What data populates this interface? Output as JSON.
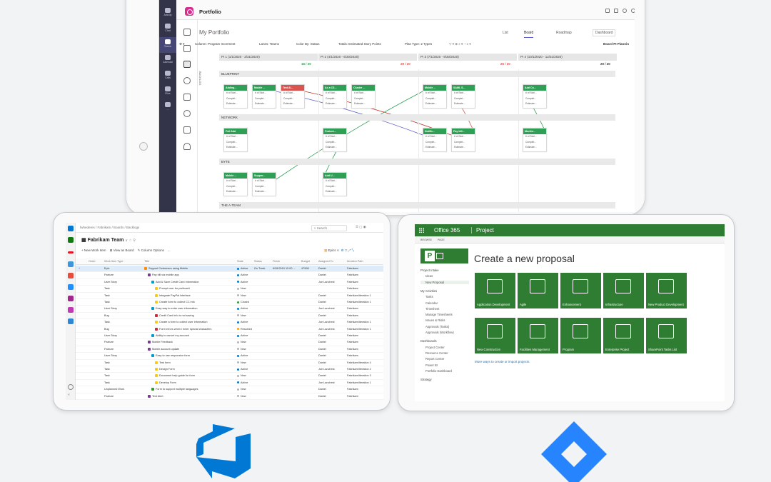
{
  "teams": {
    "rail": [
      {
        "label": "Activity"
      },
      {
        "label": "Chat"
      },
      {
        "label": "Teams",
        "active": true
      },
      {
        "label": "Calendar"
      },
      {
        "label": "Calls"
      },
      {
        "label": "Files"
      },
      {
        "label": "..."
      }
    ],
    "app_title": "Portfolio",
    "page_title": "My Portfolio",
    "views": [
      "List",
      "Board",
      "Roadmap",
      "Dashboard"
    ],
    "active_view": "Board",
    "filters": {
      "column": "Column: Program Increment",
      "lanes": "Lanes: Teams",
      "color": "Color By: Status",
      "totals": "Totals: Estimated Story Points",
      "plan": "Plan Type: 2 Types",
      "board": "Board PI Plannin"
    },
    "side_tab": "BACKLOG",
    "pis": [
      {
        "label": "PI 1 (1/1/2020 - 3/31/2020)",
        "count": "16 / 20",
        "color": "#2e9f55"
      },
      {
        "label": "PI 2 (4/1/2020 - 6/30/2020)",
        "count": "29 / 20",
        "color": "#d9534f"
      },
      {
        "label": "PI 3 (7/1/2020 - 9/30/2020)",
        "count": "25 / 20",
        "color": "#d9534f"
      },
      {
        "label": "PI 4 (10/1/2020 - 12/31/2020)",
        "count": "20 / 20",
        "color": "#333333"
      }
    ],
    "lanes": [
      "BLUEPRINT",
      "NETWORK",
      "BYTE",
      "THE A-TEAM"
    ],
    "card_lines": [
      "# of Stori...",
      "Complet...",
      "Estimate..."
    ],
    "cards": [
      {
        "title": "Adding...",
        "lane": 0,
        "col": 0,
        "slot": 0,
        "red": false
      },
      {
        "title": "Mobile ...",
        "lane": 0,
        "col": 0,
        "slot": 1,
        "red": false
      },
      {
        "title": "Test Al...",
        "lane": 0,
        "col": 0,
        "slot": 2,
        "red": true
      },
      {
        "title": "As a CS...",
        "lane": 0,
        "col": 1,
        "slot": 0,
        "red": false
      },
      {
        "title": "Cluster ...",
        "lane": 0,
        "col": 1,
        "slot": 1,
        "red": false
      },
      {
        "title": "Mobile ...",
        "lane": 0,
        "col": 2,
        "slot": 0,
        "red": false
      },
      {
        "title": "SAML S...",
        "lane": 0,
        "col": 2,
        "slot": 1,
        "red": false
      },
      {
        "title": "Add Co...",
        "lane": 0,
        "col": 3,
        "slot": 0,
        "red": false
      },
      {
        "title": "Full Add",
        "lane": 1,
        "col": 0,
        "slot": 0,
        "red": false
      },
      {
        "title": "Feature...",
        "lane": 1,
        "col": 1,
        "slot": 0,
        "red": false
      },
      {
        "title": "Notific...",
        "lane": 1,
        "col": 2,
        "slot": 0,
        "red": false
      },
      {
        "title": "Pay bill...",
        "lane": 1,
        "col": 2,
        "slot": 1,
        "red": false
      },
      {
        "title": "Monito...",
        "lane": 1,
        "col": 3,
        "slot": 0,
        "red": false
      },
      {
        "title": "Mobile ...",
        "lane": 2,
        "col": 0,
        "slot": 0,
        "red": false
      },
      {
        "title": "Suppor...",
        "lane": 2,
        "col": 0,
        "slot": 1,
        "red": false
      },
      {
        "title": "Add U...",
        "lane": 2,
        "col": 1,
        "slot": 0,
        "red": false
      }
    ]
  },
  "ado": {
    "breadcrumb": "fwhederes  /  Fabrikam  /  Boards  /  Backlogs",
    "search": "Search",
    "team": "Fabrikam Team",
    "toolbar": [
      "+ New Work Item",
      "View as Board",
      "Column Options",
      "..."
    ],
    "epics": "Epics",
    "columns": [
      "Order",
      "Work Item Type",
      "Title",
      "State",
      "Status",
      "Finish",
      "Budget",
      "Assigned To",
      "Iteration Path"
    ],
    "rows": [
      {
        "type": "Epic",
        "title": "Support Customers using Mobile",
        "state": "Active",
        "status": "On Track",
        "finish": "6/28/2019 12:00 ...",
        "budget": "47598",
        "assigned": "Daniel",
        "iter": "Fabrikam",
        "sel": true,
        "ind": 0,
        "tc": "#ff8c00"
      },
      {
        "type": "Feature",
        "title": "Pay bill via mobile app",
        "state": "Active",
        "status": "",
        "finish": "",
        "budget": "",
        "assigned": "Daniel",
        "iter": "Fabrikam",
        "ind": 1,
        "tc": "#773b93"
      },
      {
        "type": "User Story",
        "title": "Add & Save Credit Card Information",
        "state": "Active",
        "status": "",
        "finish": "",
        "budget": "",
        "assigned": "Joe Lanchest",
        "iter": "Fabrikam",
        "ind": 2,
        "tc": "#009ccc"
      },
      {
        "type": "Task",
        "title": "Prompt user for pw/boarit",
        "state": "New",
        "status": "",
        "finish": "",
        "budget": "",
        "assigned": "",
        "iter": "Fabrikam",
        "ind": 3,
        "tc": "#f2cb1d"
      },
      {
        "type": "Task",
        "title": "Integrate PayPal interface",
        "state": "New",
        "status": "",
        "finish": "",
        "budget": "",
        "assigned": "Daniel",
        "iter": "Fabrikam\\Iteration 1",
        "ind": 3,
        "tc": "#f2cb1d"
      },
      {
        "type": "Task",
        "title": "Create form to collect CC info",
        "state": "Closed",
        "status": "",
        "finish": "",
        "budget": "",
        "assigned": "Daniel",
        "iter": "Fabrikam\\Iteration 1",
        "ind": 3,
        "tc": "#f2cb1d"
      },
      {
        "type": "User Story",
        "title": "Easy way to enter user information",
        "state": "Active",
        "status": "",
        "finish": "",
        "budget": "",
        "assigned": "Joe Lanchest",
        "iter": "Fabrikam",
        "ind": 2,
        "tc": "#009ccc"
      },
      {
        "type": "Bug",
        "title": "Credit Card info is not saving",
        "state": "New",
        "status": "",
        "finish": "",
        "budget": "",
        "assigned": "Daniel",
        "iter": "Fabrikam",
        "ind": 3,
        "tc": "#cc293d"
      },
      {
        "type": "Task",
        "title": "Create a form to collect user information",
        "state": "Active",
        "status": "",
        "finish": "",
        "budget": "",
        "assigned": "Joe Lanchest",
        "iter": "Fabrikam\\Iteration 1",
        "ind": 3,
        "tc": "#f2cb1d"
      },
      {
        "type": "Bug",
        "title": "Form errors when I enter special characters",
        "state": "Resolved",
        "status": "",
        "finish": "",
        "budget": "",
        "assigned": "Joe Lanchest",
        "iter": "Fabrikam\\Iteration 1",
        "ind": 3,
        "tc": "#cc293d"
      },
      {
        "type": "User Story",
        "title": "Ability to cancel my account",
        "state": "Active",
        "status": "",
        "finish": "",
        "budget": "",
        "assigned": "Daniel",
        "iter": "Fabrikam",
        "ind": 2,
        "tc": "#009ccc"
      },
      {
        "type": "Feature",
        "title": "Mobile Feedback",
        "state": "New",
        "status": "",
        "finish": "",
        "budget": "",
        "assigned": "Daniel",
        "iter": "Fabrikam",
        "ind": 1,
        "tc": "#773b93"
      },
      {
        "type": "Feature",
        "title": "Mobile account update",
        "state": "New",
        "status": "",
        "finish": "",
        "budget": "",
        "assigned": "Daniel",
        "iter": "Fabrikam",
        "ind": 1,
        "tc": "#773b93"
      },
      {
        "type": "User Story",
        "title": "Easy to use responsive form",
        "state": "Active",
        "status": "",
        "finish": "",
        "budget": "",
        "assigned": "Daniel",
        "iter": "Fabrikam",
        "ind": 2,
        "tc": "#009ccc"
      },
      {
        "type": "Task",
        "title": "Test form",
        "state": "New",
        "status": "",
        "finish": "",
        "budget": "",
        "assigned": "Daniel",
        "iter": "Fabrikam\\Iteration 4",
        "ind": 3,
        "tc": "#f2cb1d"
      },
      {
        "type": "Task",
        "title": "Design Form",
        "state": "Active",
        "status": "",
        "finish": "",
        "budget": "",
        "assigned": "Joe Lanchest",
        "iter": "Fabrikam\\Iteration 2",
        "ind": 3,
        "tc": "#f2cb1d"
      },
      {
        "type": "Task",
        "title": "Document help guide for form",
        "state": "New",
        "status": "",
        "finish": "",
        "budget": "",
        "assigned": "Daniel",
        "iter": "Fabrikam\\Iteration 3",
        "ind": 3,
        "tc": "#f2cb1d"
      },
      {
        "type": "Task",
        "title": "Develop Form",
        "state": "Active",
        "status": "",
        "finish": "",
        "budget": "",
        "assigned": "Joe Lanchest",
        "iter": "Fabrikam\\Iteration 1",
        "ind": 3,
        "tc": "#f2cb1d"
      },
      {
        "type": "Unplanned Work",
        "title": "Form to support multiple languages",
        "state": "New",
        "status": "",
        "finish": "",
        "budget": "",
        "assigned": "Daniel",
        "iter": "Fabrikam",
        "ind": 2,
        "tc": "#339933"
      },
      {
        "type": "Feature",
        "title": "Text Alert",
        "state": "New",
        "status": "",
        "finish": "",
        "budget": "",
        "assigned": "Daniel",
        "iter": "Fabrikam",
        "ind": 1,
        "tc": "#773b93"
      }
    ]
  },
  "o365": {
    "suite": "Office 365",
    "app": "Project",
    "ribbon": [
      "BROWSE",
      "PAGE"
    ],
    "title": "Create a new proposal",
    "nav": [
      {
        "label": "Project Intake",
        "sub": false
      },
      {
        "label": "Ideas",
        "sub": true
      },
      {
        "label": "New Proposal",
        "sub": true,
        "active": true
      },
      {
        "label": "My Activities",
        "sub": false,
        "gap": true
      },
      {
        "label": "Tasks",
        "sub": true
      },
      {
        "label": "Calendar",
        "sub": true
      },
      {
        "label": "Timesheet",
        "sub": true
      },
      {
        "label": "Manage Timesheets",
        "sub": true
      },
      {
        "label": "Issues & Risks",
        "sub": true
      },
      {
        "label": "Approvals (Tasks)",
        "sub": true
      },
      {
        "label": "Approvals (Workflow)",
        "sub": true
      },
      {
        "label": "Dashboards",
        "sub": false,
        "gap": true
      },
      {
        "label": "Project Center",
        "sub": true
      },
      {
        "label": "Resource Center",
        "sub": true
      },
      {
        "label": "Report Center",
        "sub": true
      },
      {
        "label": "Power BI",
        "sub": true
      },
      {
        "label": "Portfolio Dashboard",
        "sub": true
      },
      {
        "label": "Strategy",
        "sub": false,
        "gap": true
      }
    ],
    "tiles": [
      "Application Development",
      "Agile",
      "Enhancement",
      "Infrastructure",
      "New Product Development",
      "New Construction",
      "Facilities Management",
      "Program",
      "Enterprise Project",
      "SharePoint Tasks List"
    ],
    "more_link": "More ways to create or import projects",
    "brand_green": "#2e7d32"
  },
  "logos": {
    "azure_devops": "azure-devops-logo",
    "jira": "jira-logo",
    "azure_color": "#0078d4",
    "jira_color": "#2684ff"
  }
}
